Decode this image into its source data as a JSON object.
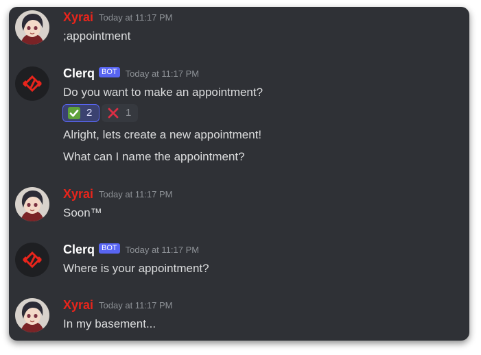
{
  "messages": [
    {
      "author": "Xyrai",
      "timestamp": "Today at 11:17 PM",
      "avatar_icon": "anime-avatar-icon",
      "lines": [
        ";appointment"
      ]
    },
    {
      "author": "Clerq",
      "bot_tag": "BOT",
      "timestamp": "Today at 11:17 PM",
      "avatar_icon": "red-diamond-logo-icon",
      "lines": [
        "Do you want to make an appointment?"
      ],
      "reactions": [
        {
          "emoji": "check-mark-button-icon",
          "count": "2",
          "active": true
        },
        {
          "emoji": "cross-mark-icon",
          "count": "1",
          "active": false
        }
      ],
      "followups": [
        "Alright, lets create a new appointment!",
        "What can I name the appointment?"
      ]
    },
    {
      "author": "Xyrai",
      "timestamp": "Today at 11:17 PM",
      "avatar_icon": "anime-avatar-icon",
      "lines": [
        "Soon™"
      ]
    },
    {
      "author": "Clerq",
      "bot_tag": "BOT",
      "timestamp": "Today at 11:17 PM",
      "avatar_icon": "red-diamond-logo-icon",
      "lines": [
        "Where is your appointment?"
      ]
    },
    {
      "author": "Xyrai",
      "timestamp": "Today at 11:17 PM",
      "avatar_icon": "anime-avatar-icon",
      "lines": [
        "In my basement..."
      ]
    }
  ],
  "colors": {
    "background": "#2f3136",
    "user_name": "#e8251c",
    "bot_tag": "#5865f2",
    "text": "#dcddde",
    "timestamp": "#8e9297"
  }
}
